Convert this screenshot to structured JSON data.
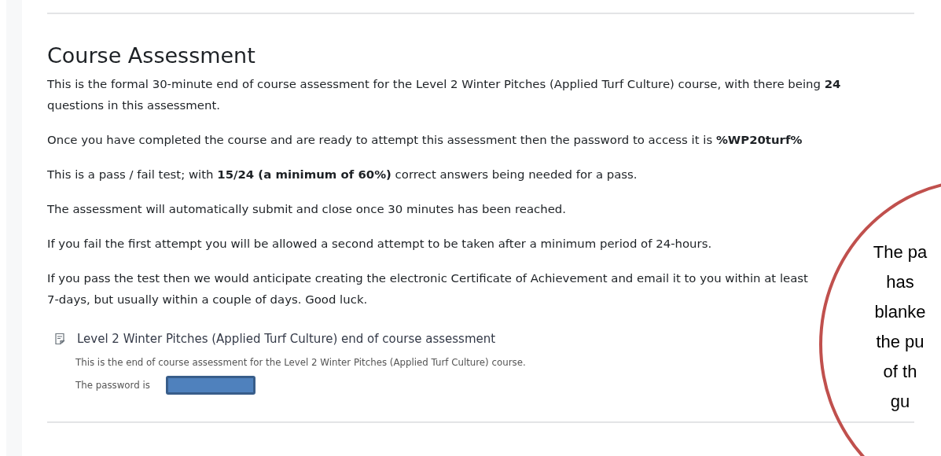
{
  "section": {
    "title": "Course Assessment",
    "paragraphs": [
      "This is the formal 30-minute end of course assessment for the Level 2 Winter Pitches (Applied Turf Culture) course, with there being **24** questions in this assessment.",
      "Once you have completed the course and are ready to attempt this assessment then the password to access it is **%WP20turf%**",
      "This is a pass / fail test; with **15/24 (a minimum of 60%)** correct answers being needed for a pass.",
      "The assessment will automatically submit and close once 30 minutes has been reached.",
      "If you fail the first attempt you will be allowed a second attempt to be taken after a minimum period of 24-hours.",
      "If you pass the test then we would anticipate creating the electronic Certificate of Achievement and email it to you within at least 7-days, but usually within a couple of days. Good luck."
    ],
    "activity": {
      "name": "Level 2 Winter Pitches (Applied Turf Culture) end of course assessment",
      "description": "This is the end of course assessment for the Level 2 Winter Pitches (Applied Turf Culture) course.",
      "password_label": "The password is"
    }
  },
  "callout": {
    "lines": [
      "The pa",
      "has",
      "blanke",
      "the pu",
      "of th",
      "gu"
    ]
  }
}
